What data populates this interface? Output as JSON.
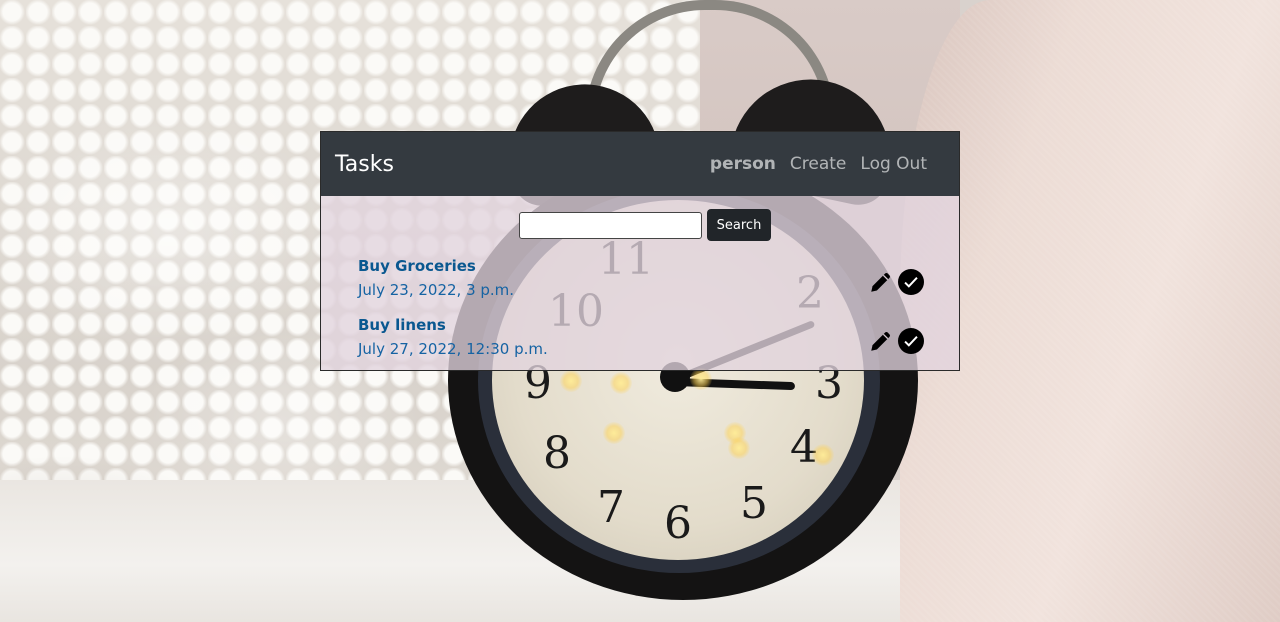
{
  "navbar": {
    "brand": "Tasks",
    "user": "person",
    "links": {
      "create": "Create",
      "logout": "Log Out"
    }
  },
  "search": {
    "value": "",
    "placeholder": "",
    "button_label": "Search"
  },
  "tasks": [
    {
      "title": "Buy Groceries",
      "due": "July 23, 2022, 3 p.m.",
      "actions": [
        "pencil-icon",
        "checkmark-circle-icon"
      ]
    },
    {
      "title": "Buy linens",
      "due": "July 27, 2022, 12:30 p.m.",
      "actions": [
        "pencil-icon",
        "checkmark-circle-icon"
      ]
    }
  ],
  "colors": {
    "navbar_bg": "#343a40",
    "link": "#0a5890",
    "button_bg": "#212529"
  },
  "background": {
    "clock_numerals": [
      "11",
      "10",
      "9",
      "8",
      "7",
      "6",
      "5",
      "4",
      "3",
      "2"
    ]
  }
}
